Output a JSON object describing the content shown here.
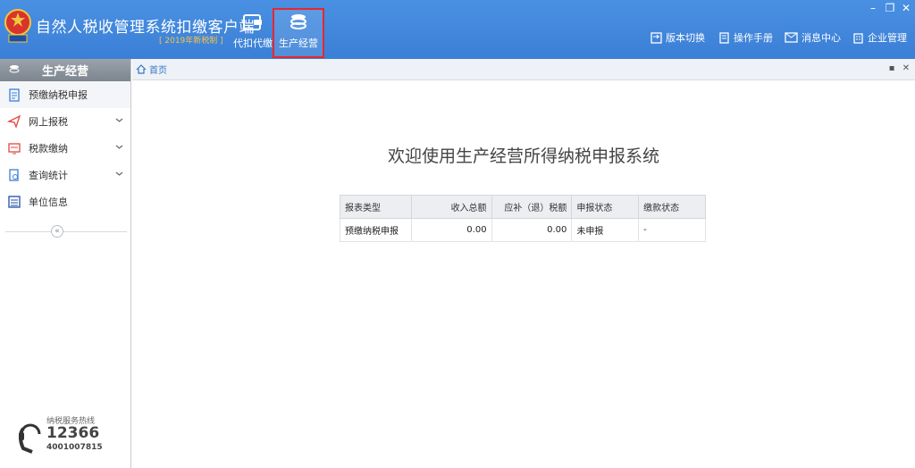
{
  "app": {
    "title": "自然人税收管理系统扣缴客户端",
    "subtitle": "[ 2019年新税制 ]",
    "modules": [
      {
        "label": "代扣代缴"
      },
      {
        "label": "生产经营"
      }
    ],
    "right_menu": [
      {
        "label": "版本切换",
        "icon": "switch-icon"
      },
      {
        "label": "操作手册",
        "icon": "manual-icon"
      },
      {
        "label": "消息中心",
        "icon": "mail-icon"
      },
      {
        "label": "企业管理",
        "icon": "building-icon"
      }
    ],
    "window_controls": [
      "–",
      "❐",
      "✕"
    ]
  },
  "sidebar": {
    "title": "生产经营",
    "items": [
      {
        "label": "预缴纳税申报",
        "icon": "clipboard-icon",
        "expandable": false
      },
      {
        "label": "网上报税",
        "icon": "send-icon",
        "expandable": true
      },
      {
        "label": "税款缴纳",
        "icon": "payment-icon",
        "expandable": true
      },
      {
        "label": "查询统计",
        "icon": "search-doc-icon",
        "expandable": true
      },
      {
        "label": "单位信息",
        "icon": "list-icon",
        "expandable": false
      }
    ],
    "collapse_glyph": "«",
    "hotline": {
      "label": "纳税服务热线",
      "number": "12366",
      "alt_number": "4001007815"
    }
  },
  "tabs": {
    "home_label": "首页",
    "controls": [
      "▪",
      "✕"
    ]
  },
  "main": {
    "welcome": "欢迎使用生产经营所得纳税申报系统",
    "table": {
      "headers": [
        "报表类型",
        "收入总额",
        "应补（退）税额",
        "申报状态",
        "缴款状态"
      ],
      "rows": [
        [
          "预缴纳税申报",
          "0.00",
          "0.00",
          "未申报",
          "-"
        ]
      ]
    }
  },
  "colors": {
    "header_blue": "#3a7fd6",
    "highlight_red": "#e8262d",
    "subtitle_orange": "#f6c34a",
    "link_blue": "#3477c9"
  }
}
